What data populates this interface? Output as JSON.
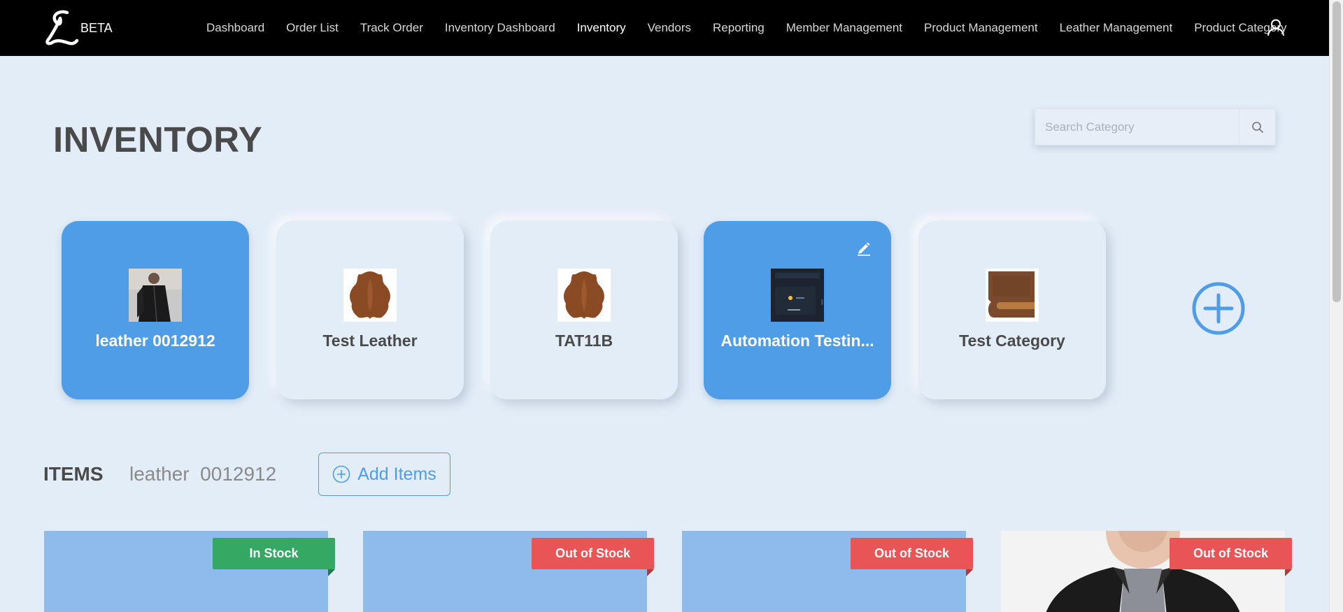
{
  "brand": {
    "logo_icon": "script-L-logo",
    "badge": "BETA"
  },
  "nav": {
    "items": [
      {
        "label": "Dashboard",
        "active": false
      },
      {
        "label": "Order List",
        "active": false
      },
      {
        "label": "Track Order",
        "active": false
      },
      {
        "label": "Inventory Dashboard",
        "active": false
      },
      {
        "label": "Inventory",
        "active": true
      },
      {
        "label": "Vendors",
        "active": false
      },
      {
        "label": "Reporting",
        "active": false
      },
      {
        "label": "Member Management",
        "active": false
      },
      {
        "label": "Product Management",
        "active": false
      },
      {
        "label": "Leather Management",
        "active": false
      },
      {
        "label": "Product Category",
        "active": false
      }
    ],
    "user_icon": "user-icon"
  },
  "page": {
    "title": "INVENTORY"
  },
  "search": {
    "placeholder": "Search Category",
    "value": "",
    "icon": "search-icon"
  },
  "categories": [
    {
      "label": "leather 0012912",
      "selected": true,
      "thumb": "leather-jacket-photo"
    },
    {
      "label": "Test Leather",
      "selected": false,
      "thumb": "leather-hide-photo"
    },
    {
      "label": "TAT11B",
      "selected": false,
      "thumb": "leather-hide-photo"
    },
    {
      "label": "Automation Testin...",
      "selected": true,
      "thumb": "dark-app-screenshot",
      "edit_icon": "pencil-icon"
    },
    {
      "label": "Test Category",
      "selected": false,
      "thumb": "folded-leather-photo"
    }
  ],
  "add_category_icon": "plus-circle-icon",
  "items_section": {
    "title": "ITEMS",
    "subtitle": "leather  0012912",
    "add_button_label": "Add Items",
    "add_button_icon": "plus-circle-icon"
  },
  "products": [
    {
      "stock_label": "In Stock",
      "status": "in"
    },
    {
      "stock_label": "Out of Stock",
      "status": "out"
    },
    {
      "stock_label": "Out of Stock",
      "status": "out"
    },
    {
      "stock_label": "Out of Stock",
      "status": "out",
      "image": "leather-jacket-model-photo"
    }
  ],
  "colors": {
    "navbar": "#000000",
    "background": "#e3edf7",
    "accent_blue": "#4e9de6",
    "product_placeholder": "#8fbbeb",
    "in_stock": "#35a864",
    "out_of_stock": "#e95557"
  }
}
